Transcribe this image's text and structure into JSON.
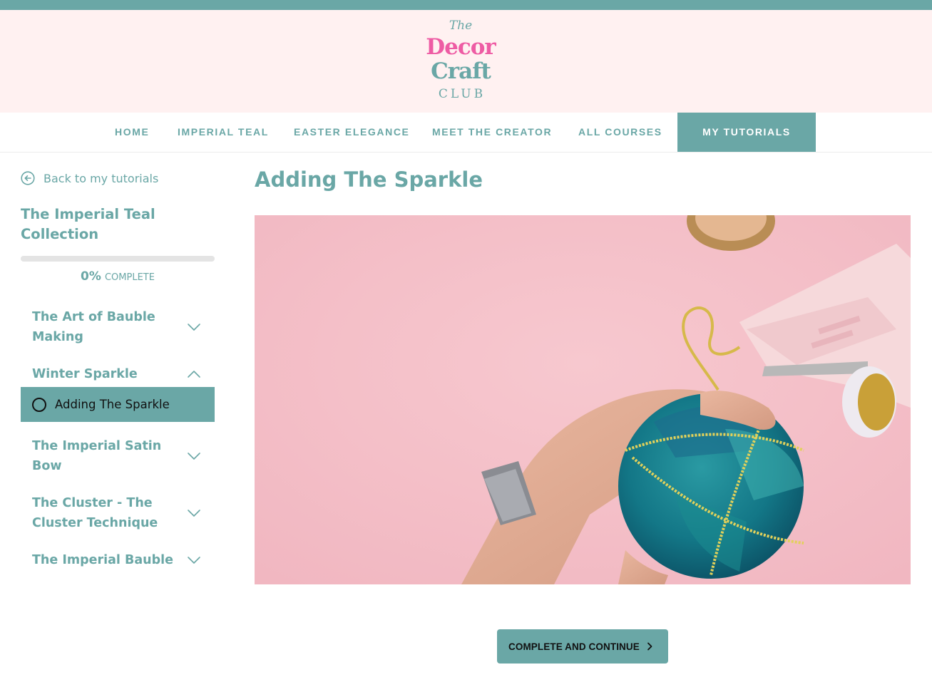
{
  "logo": {
    "the": "The",
    "decor": "Decor",
    "craft": "Craft",
    "club": "CLUB"
  },
  "nav": {
    "items": [
      {
        "label": "HOME"
      },
      {
        "label": "IMPERIAL TEAL"
      },
      {
        "label": "EASTER ELEGANCE"
      },
      {
        "label": "MEET THE CREATOR"
      },
      {
        "label": "ALL COURSES"
      },
      {
        "label": "MY TUTORIALS",
        "active": true
      }
    ]
  },
  "sidebar": {
    "back_label": "Back to my tutorials",
    "course_title": "The Imperial Teal Collection",
    "progress": {
      "percent": 0,
      "percent_label": "0%",
      "complete_label": "COMPLETE"
    },
    "sections": [
      {
        "title": "The Art of Bauble Making",
        "expanded": false
      },
      {
        "title": "Winter Sparkle",
        "expanded": true,
        "lessons": [
          {
            "title": "Adding The Sparkle",
            "active": true
          }
        ]
      },
      {
        "title": "The Imperial Satin Bow",
        "expanded": false
      },
      {
        "title": "The Cluster - The Cluster Technique",
        "expanded": false
      },
      {
        "title": "The Imperial Bauble",
        "expanded": false
      }
    ]
  },
  "main": {
    "lesson_title": "Adding The Sparkle",
    "cta_label": "COMPLETE AND CONTINUE"
  },
  "colors": {
    "teal": "#6aa7a6",
    "pink": "#ee5ca4",
    "header_bg": "#fff1f1"
  }
}
